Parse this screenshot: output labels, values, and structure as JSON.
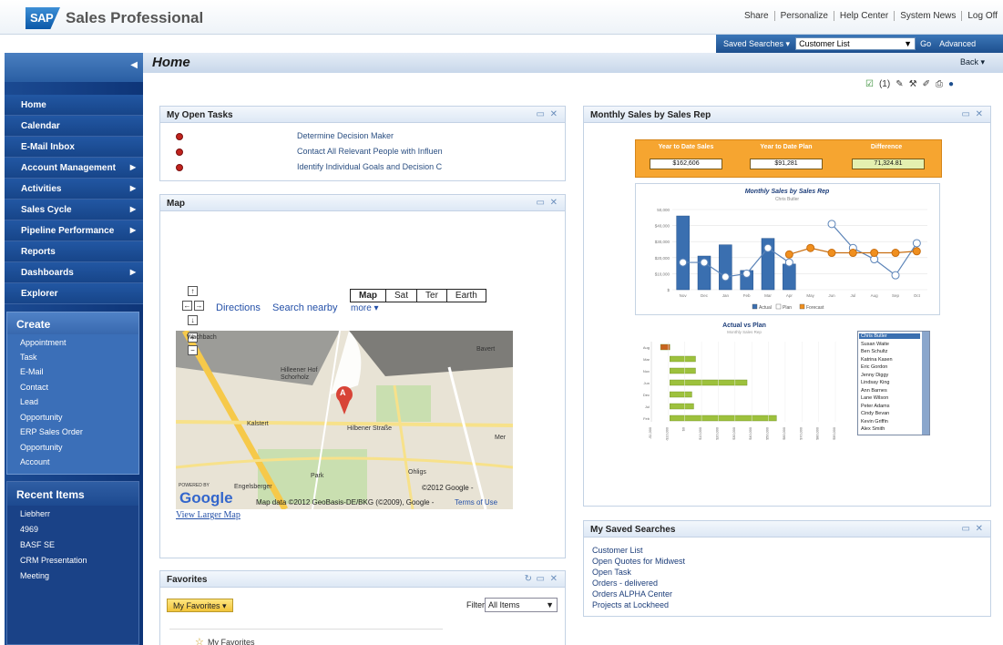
{
  "app": {
    "logo": "SAP",
    "title": "Sales Professional"
  },
  "top_links": [
    "Share",
    "Personalize",
    "Help Center",
    "System News",
    "Log Off"
  ],
  "search": {
    "saved_label": "Saved Searches ▾",
    "selected": "Customer List",
    "go": "Go",
    "advanced": "Advanced"
  },
  "sidebar": {
    "nav": [
      {
        "label": "Home",
        "arrow": false
      },
      {
        "label": "Calendar",
        "arrow": false
      },
      {
        "label": "E-Mail Inbox",
        "arrow": false
      },
      {
        "label": "Account Management",
        "arrow": true
      },
      {
        "label": "Activities",
        "arrow": true
      },
      {
        "label": "Sales Cycle",
        "arrow": true
      },
      {
        "label": "Pipeline Performance",
        "arrow": true
      },
      {
        "label": "Reports",
        "arrow": false
      },
      {
        "label": "Dashboards",
        "arrow": true
      },
      {
        "label": "Explorer",
        "arrow": false
      }
    ],
    "create_title": "Create",
    "create_items": [
      "Appointment",
      "Task",
      "E-Mail",
      "Contact",
      "Lead",
      "Opportunity",
      "ERP Sales Order",
      "Opportunity",
      "Account"
    ],
    "recent_title": "Recent Items",
    "recent_items": [
      "Liebherr",
      "4969",
      "BASF SE",
      "CRM Presentation",
      "Meeting"
    ]
  },
  "main": {
    "title": "Home",
    "back": "Back ▾",
    "tool_count": "(1)"
  },
  "tasks": {
    "title": "My Open Tasks",
    "items": [
      "Determine Decision Maker",
      "Contact All Relevant People with Influen",
      "Identify Individual Goals and Decision C"
    ]
  },
  "map": {
    "title": "Map",
    "directions": "Directions",
    "nearby": "Search nearby",
    "more": "more ▾",
    "types": [
      "Map",
      "Sat",
      "Ter",
      "Earth"
    ],
    "marker": "A",
    "labels": [
      "Kalstert",
      "Hilbener Straße",
      "Mer",
      "Bavert",
      "Ohligs",
      "Park",
      "Engelsberger",
      "Wachbach",
      "Hilleener Hof",
      "Schorholz"
    ],
    "powered": "POWERED BY",
    "google": "Google",
    "copyright": "©2012 Google -",
    "data_credit": "Map data ©2012 GeoBasis-DE/BKG (©2009), Google -",
    "terms": "Terms of Use",
    "larger_link": "View Larger Map"
  },
  "favorites": {
    "title": "Favorites",
    "button": "My Favorites ▾",
    "filter_label": "Filter",
    "filter_value": "All Items",
    "item": "My Favorites"
  },
  "monthly": {
    "title": "Monthly Sales by Sales Rep",
    "kpis": [
      {
        "label": "Year to Date Sales",
        "value": "$162,606"
      },
      {
        "label": "Year to Date Plan",
        "value": "$91,281"
      },
      {
        "label": "Difference",
        "value": "71,324.81"
      }
    ]
  },
  "chart_data": [
    {
      "type": "bar",
      "title": "Monthly Sales by Sales Rep",
      "subtitle": "Chris Butler",
      "categories": [
        "Nov",
        "Dec",
        "Jan",
        "Feb",
        "Mar",
        "Apr",
        "May",
        "Jun",
        "Jul",
        "Aug",
        "Sep",
        "Oct"
      ],
      "series": [
        {
          "name": "Actual",
          "kind": "bar",
          "values": [
            46000,
            21000,
            28000,
            12000,
            32000,
            16000,
            null,
            null,
            null,
            null,
            null,
            null
          ]
        },
        {
          "name": "Plan",
          "kind": "line",
          "values": [
            17000,
            17000,
            8000,
            10000,
            26000,
            17000,
            null,
            41000,
            26000,
            19000,
            9000,
            29000
          ]
        },
        {
          "name": "Forecast",
          "kind": "line",
          "values": [
            null,
            null,
            null,
            null,
            null,
            22000,
            26000,
            23000,
            23000,
            23000,
            23000,
            24000
          ]
        }
      ],
      "yticks": [
        "50,000",
        "$40,000",
        "$30,000",
        "$20,000",
        "$10,000",
        "$"
      ],
      "ylim": [
        0,
        50000
      ],
      "legend": "bottom"
    },
    {
      "type": "bar",
      "orientation": "horizontal",
      "title": "Actual vs Plan",
      "subtitle": "Monthly Sales Rep",
      "categories": [
        "Aug",
        "Mar",
        "Nov",
        "Jun",
        "Dec",
        "Jul",
        "Feb"
      ],
      "values": [
        -5000,
        14000,
        14000,
        42000,
        12000,
        13000,
        58000
      ],
      "xticks": [
        "-$1,000",
        "-$10,000",
        "$0",
        "$10,000",
        "$20,000",
        "$30,000",
        "$40,000",
        "$50,000",
        "$60,000",
        "$70,000",
        "$80,000",
        "$90,000"
      ],
      "reps": [
        "Chris Butler",
        "Susan Waite",
        "Ben Schultz",
        "Katrina Kasen",
        "Eric Gordon",
        "Jenny Diggy",
        "Lindsay King",
        "Ann Barnes",
        "Lane Wilson",
        "Peter Adams",
        "Cindy Bevan",
        "Kevin Griffin",
        "Alex Smith"
      ]
    }
  ],
  "saved_searches": {
    "title": "My Saved Searches",
    "items": [
      "Customer List",
      "Open Quotes for Midwest",
      "Open Task",
      "Orders - delivered",
      "Orders ALPHA Center",
      "Projects at Lockheed"
    ]
  },
  "colors": {
    "accent": "#1d4f8e",
    "bar": "#3a6fb0",
    "forecast": "#f08f1e",
    "kpi_bg": "#f6a530",
    "hbar": "#9dc13d"
  }
}
